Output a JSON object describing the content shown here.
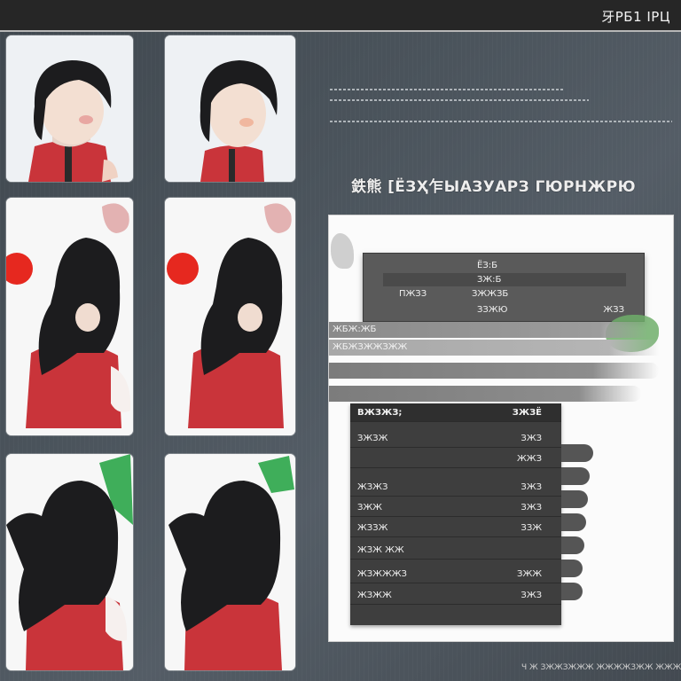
{
  "window": {
    "title": "牙РБ1 ІРЦ"
  },
  "headline": "鉄熊 [ЁЗҲ乍ЫАЗУАРЗ ГЮРНЖРЮ",
  "popup": {
    "title": "ЁЗ:Б",
    "rows": [
      {
        "key": "",
        "val": "ЗЖ:Б"
      },
      {
        "key": "ПЖЗЗ",
        "val": "ЗЖЖЗБ"
      },
      {
        "key": "",
        "val": "ЗЗЖЮ"
      }
    ],
    "value": "ЖЗЗ"
  },
  "rules": [
    "ЖБЖ:ЖБ",
    "ЖБЖЗЖЖЗЖЖ"
  ],
  "table": {
    "header": {
      "left": "ВЖЗЖЗ;",
      "right": "ЗЖЗЁ"
    },
    "rows": [
      {
        "left": "ЗЖЗЖ",
        "right": "ЗЖЗ"
      },
      {
        "left": "",
        "right": "ЖЖЗ"
      },
      {
        "left": "ЖЗЖЗ",
        "right": "ЗЖЗ"
      },
      {
        "left": "ЗЖЖ",
        "right": "ЗЖЗ"
      },
      {
        "left": "ЖЗЗЖ",
        "right": "ЗЗЖ"
      },
      {
        "left": "ЖЗЖ ЖЖ",
        "right": ""
      },
      {
        "left": "ЖЗЖЖЖЗ",
        "right": "ЗЖЖ"
      },
      {
        "left": "ЖЗЖЖ",
        "right": "ЗЖЗ"
      }
    ]
  },
  "footer": "Ч Ж ЗЖЖЗЖЖЖ ЖЖЖЖЗЖЖ ЖЖЖ",
  "colors": {
    "titlebar": "#262626",
    "jacket": "#c9343a",
    "hair": "#1c1c1e",
    "accent_green": "#6fae6a",
    "accent_red": "#e6281f"
  },
  "thumbnails": [
    {
      "icon": "character-portrait-icon"
    },
    {
      "icon": "character-portrait-icon"
    },
    {
      "icon": "character-back-icon"
    },
    {
      "icon": "character-back-icon"
    },
    {
      "icon": "character-side-icon"
    },
    {
      "icon": "character-side-icon"
    }
  ]
}
